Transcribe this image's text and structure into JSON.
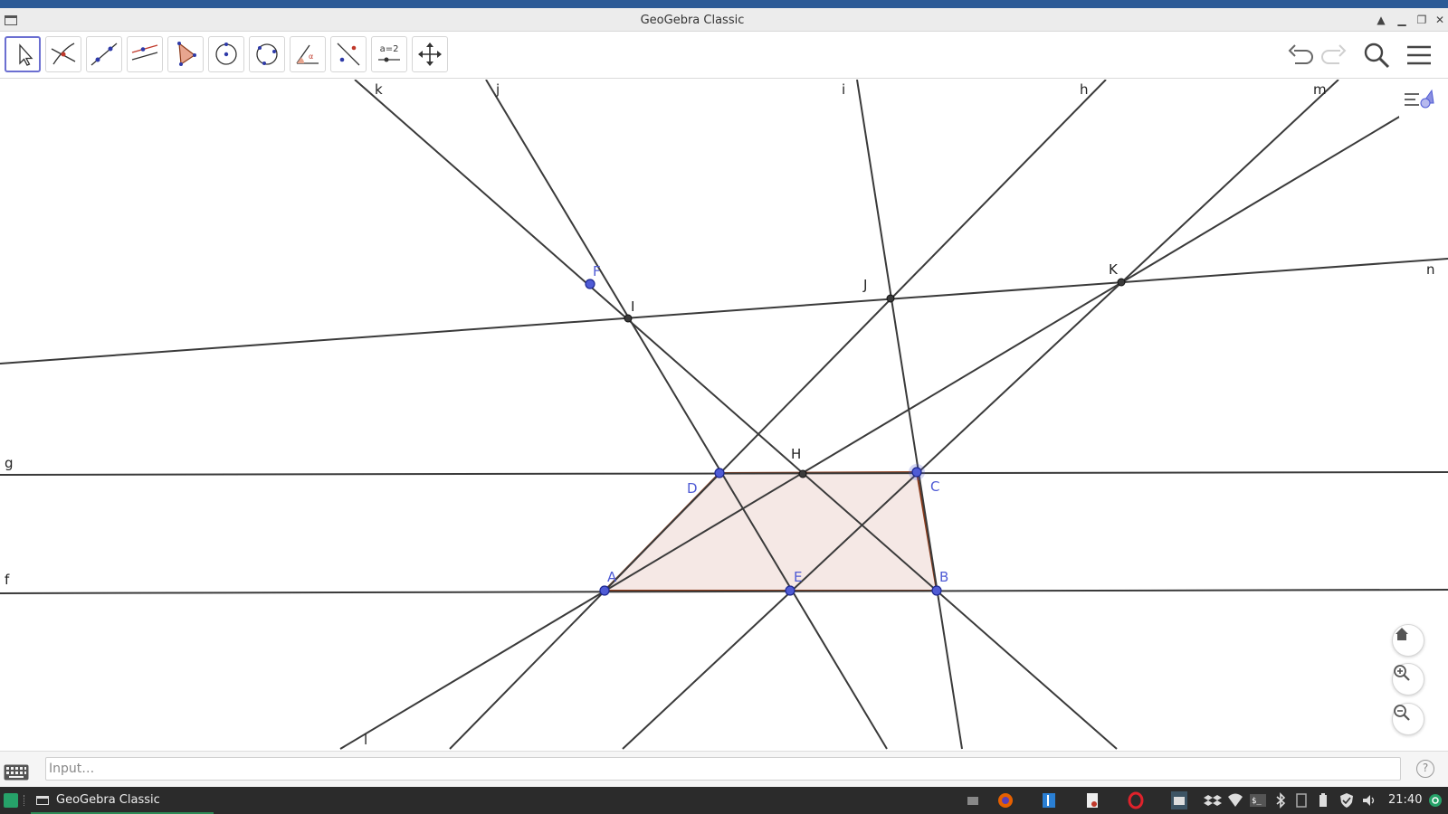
{
  "window": {
    "title": "GeoGebra Classic"
  },
  "toolbar": {
    "tools": [
      {
        "name": "move-tool",
        "label": "Move"
      },
      {
        "name": "point-tool",
        "label": "Point"
      },
      {
        "name": "line-tool",
        "label": "Line"
      },
      {
        "name": "perpendicular-line-tool",
        "label": "Perpendicular Line"
      },
      {
        "name": "polygon-tool",
        "label": "Polygon"
      },
      {
        "name": "circle-tool",
        "label": "Circle with Center through Point"
      },
      {
        "name": "ellipse-tool",
        "label": "Ellipse"
      },
      {
        "name": "angle-tool",
        "label": "Angle"
      },
      {
        "name": "reflect-tool",
        "label": "Reflect about Line"
      },
      {
        "name": "slider-tool",
        "label": "a=2"
      },
      {
        "name": "move-graphics-view-tool",
        "label": "Move Graphics View"
      }
    ],
    "slider_text": "a=2"
  },
  "graphics": {
    "line_labels": {
      "k": "k",
      "j": "j",
      "i": "i",
      "h": "h",
      "m": "m",
      "n": "n",
      "g": "g",
      "f": "f",
      "l": "l"
    },
    "point_labels": {
      "A": "A",
      "B": "B",
      "C": "C",
      "D": "D",
      "E": "E",
      "F": "F",
      "H": "H",
      "I": "I",
      "J": "J",
      "K": "K"
    },
    "colors": {
      "point_free": "#4f5bd5",
      "point_dependent": "#333333",
      "polygon_stroke": "#8b3a1a",
      "polygon_fill": "#f4e6e2",
      "line": "#3a3a3a"
    }
  },
  "input_bar": {
    "placeholder": "Input…",
    "help": "?"
  },
  "taskbar": {
    "task_label": "GeoGebra Classic",
    "clock": "21:40"
  }
}
